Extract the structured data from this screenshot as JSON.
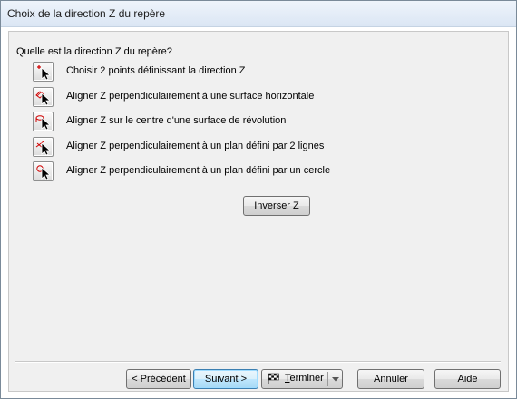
{
  "window": {
    "title": "Choix de la direction Z du repère"
  },
  "question": "Quelle est la direction Z du repère?",
  "options": [
    {
      "label": "Choisir 2 points définissant la direction Z",
      "icon": "two-points-cursor-icon"
    },
    {
      "label": "Aligner Z perpendiculairement à une surface horizontale",
      "icon": "horizontal-surface-cursor-icon"
    },
    {
      "label": "Aligner Z sur le centre d'une surface de révolution",
      "icon": "revolution-surface-cursor-icon"
    },
    {
      "label": "Aligner Z perpendiculairement à un plan défini par 2 lignes",
      "icon": "two-lines-plane-cursor-icon"
    },
    {
      "label": "Aligner Z perpendiculairement à un plan défini par un cercle",
      "icon": "circle-plane-cursor-icon"
    }
  ],
  "invert_button": "Inverser Z",
  "footer": {
    "previous": "< Précédent",
    "next": "Suivant >",
    "finish_first": "T",
    "finish_rest": "erminer",
    "cancel": "Annuler",
    "help": "Aide"
  }
}
